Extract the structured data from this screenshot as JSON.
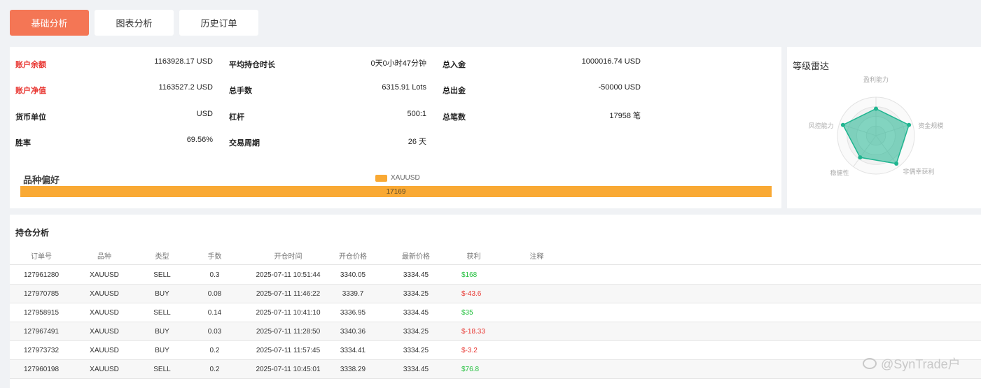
{
  "tabs": [
    {
      "label": "基础分析",
      "active": true
    },
    {
      "label": "图表分析",
      "active": false
    },
    {
      "label": "历史订单",
      "active": false
    }
  ],
  "stats": {
    "balance": {
      "label": "账户余额",
      "value": "1163928.17 USD"
    },
    "equity": {
      "label": "账户净值",
      "value": "1163527.2 USD"
    },
    "currency": {
      "label": "货币单位",
      "value": "USD"
    },
    "win_rate": {
      "label": "胜率",
      "value": "69.56%"
    },
    "avg_hold": {
      "label": "平均持仓时长",
      "value": "0天0小时47分钟"
    },
    "total_lots": {
      "label": "总手数",
      "value": "6315.91 Lots"
    },
    "leverage": {
      "label": "杠杆",
      "value": "500:1"
    },
    "period": {
      "label": "交易周期",
      "value": "26 天"
    },
    "deposit": {
      "label": "总入金",
      "value": "1000016.74 USD"
    },
    "withdraw": {
      "label": "总出金",
      "value": "-50000 USD"
    },
    "trades": {
      "label": "总笔数",
      "value": "17958 笔"
    }
  },
  "preference": {
    "title": "品种偏好",
    "legend": "XAUUSD",
    "bar_value": "17169",
    "bar_color": "#f9a934"
  },
  "radar": {
    "title": "等级雷达",
    "axes": [
      "盈利能力",
      "资金规模",
      "非偶幸获利",
      "稳健性",
      "风控能力"
    ],
    "values": [
      0.7,
      0.9,
      0.9,
      0.7,
      0.9
    ],
    "color": "#1fb590"
  },
  "positions": {
    "title": "持仓分析",
    "columns": [
      "订单号",
      "品种",
      "类型",
      "手数",
      "开仓时间",
      "开仓价格",
      "最新价格",
      "获利",
      "注释"
    ],
    "rows": [
      [
        "127961280",
        "XAUUSD",
        "SELL",
        "0.3",
        "2025-07-11 10:51:44",
        "3340.05",
        "3334.45",
        "$168",
        ""
      ],
      [
        "127970785",
        "XAUUSD",
        "BUY",
        "0.08",
        "2025-07-11 11:46:22",
        "3339.7",
        "3334.25",
        "$-43.6",
        ""
      ],
      [
        "127958915",
        "XAUUSD",
        "SELL",
        "0.14",
        "2025-07-11 10:41:10",
        "3336.95",
        "3334.45",
        "$35",
        ""
      ],
      [
        "127967491",
        "XAUUSD",
        "BUY",
        "0.03",
        "2025-07-11 11:28:50",
        "3340.36",
        "3334.25",
        "$-18.33",
        ""
      ],
      [
        "127973732",
        "XAUUSD",
        "BUY",
        "0.2",
        "2025-07-11 11:57:45",
        "3334.41",
        "3334.25",
        "$-3.2",
        ""
      ],
      [
        "127960198",
        "XAUUSD",
        "SELL",
        "0.2",
        "2025-07-11 10:45:01",
        "3338.29",
        "3334.45",
        "$76.8",
        ""
      ]
    ]
  },
  "watermark": "@SynTrade户",
  "colors": {
    "accent": "#f47655",
    "profit": "#1fbf3a",
    "loss": "#e8342f"
  }
}
